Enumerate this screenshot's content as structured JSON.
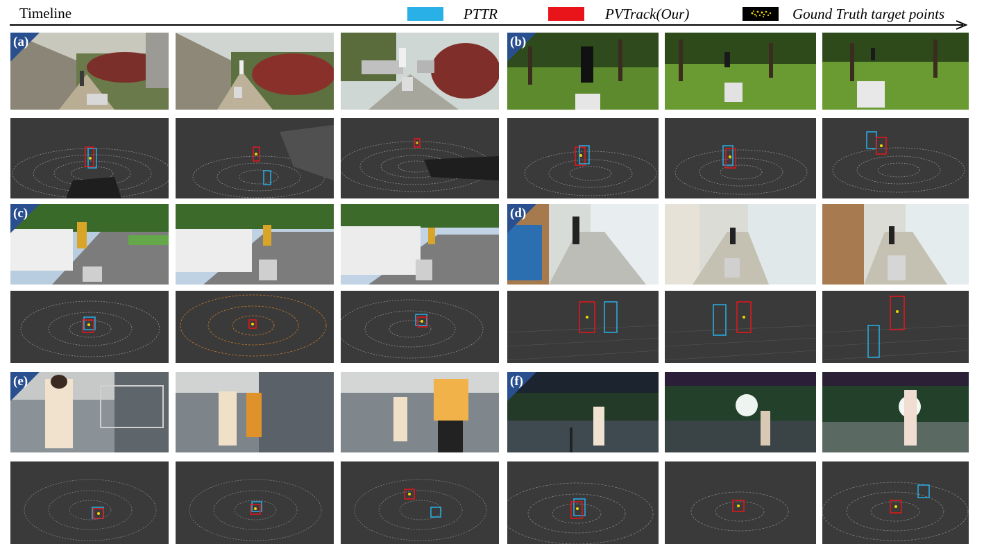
{
  "header": {
    "timeline_label": "Timeline",
    "legend": [
      {
        "label": "PTTR",
        "color": "#29b0e6"
      },
      {
        "label": "PVTrack(Our)",
        "color": "#e8141a"
      },
      {
        "label": "Gound Truth target points",
        "color": "#f5d400"
      }
    ]
  },
  "sequences": [
    {
      "id": "a",
      "label": "(a)",
      "scene": "campus-path-daylight"
    },
    {
      "id": "b",
      "label": "(b)",
      "scene": "tree-lawn-daylight"
    },
    {
      "id": "c",
      "label": "(c)",
      "scene": "street-parked-cars"
    },
    {
      "id": "d",
      "label": "(d)",
      "scene": "indoor-corridor"
    },
    {
      "id": "e",
      "label": "(e)",
      "scene": "indoor-hall-stairs"
    },
    {
      "id": "f",
      "label": "(f)",
      "scene": "night-plaza"
    }
  ],
  "colors": {
    "pttr_box": "#29b0e6",
    "pvtrack_box": "#e8141a",
    "gt_points": "#f5d400",
    "cloud_bg": "#3a3a3a",
    "tag_bg": "#2a4f8f"
  }
}
